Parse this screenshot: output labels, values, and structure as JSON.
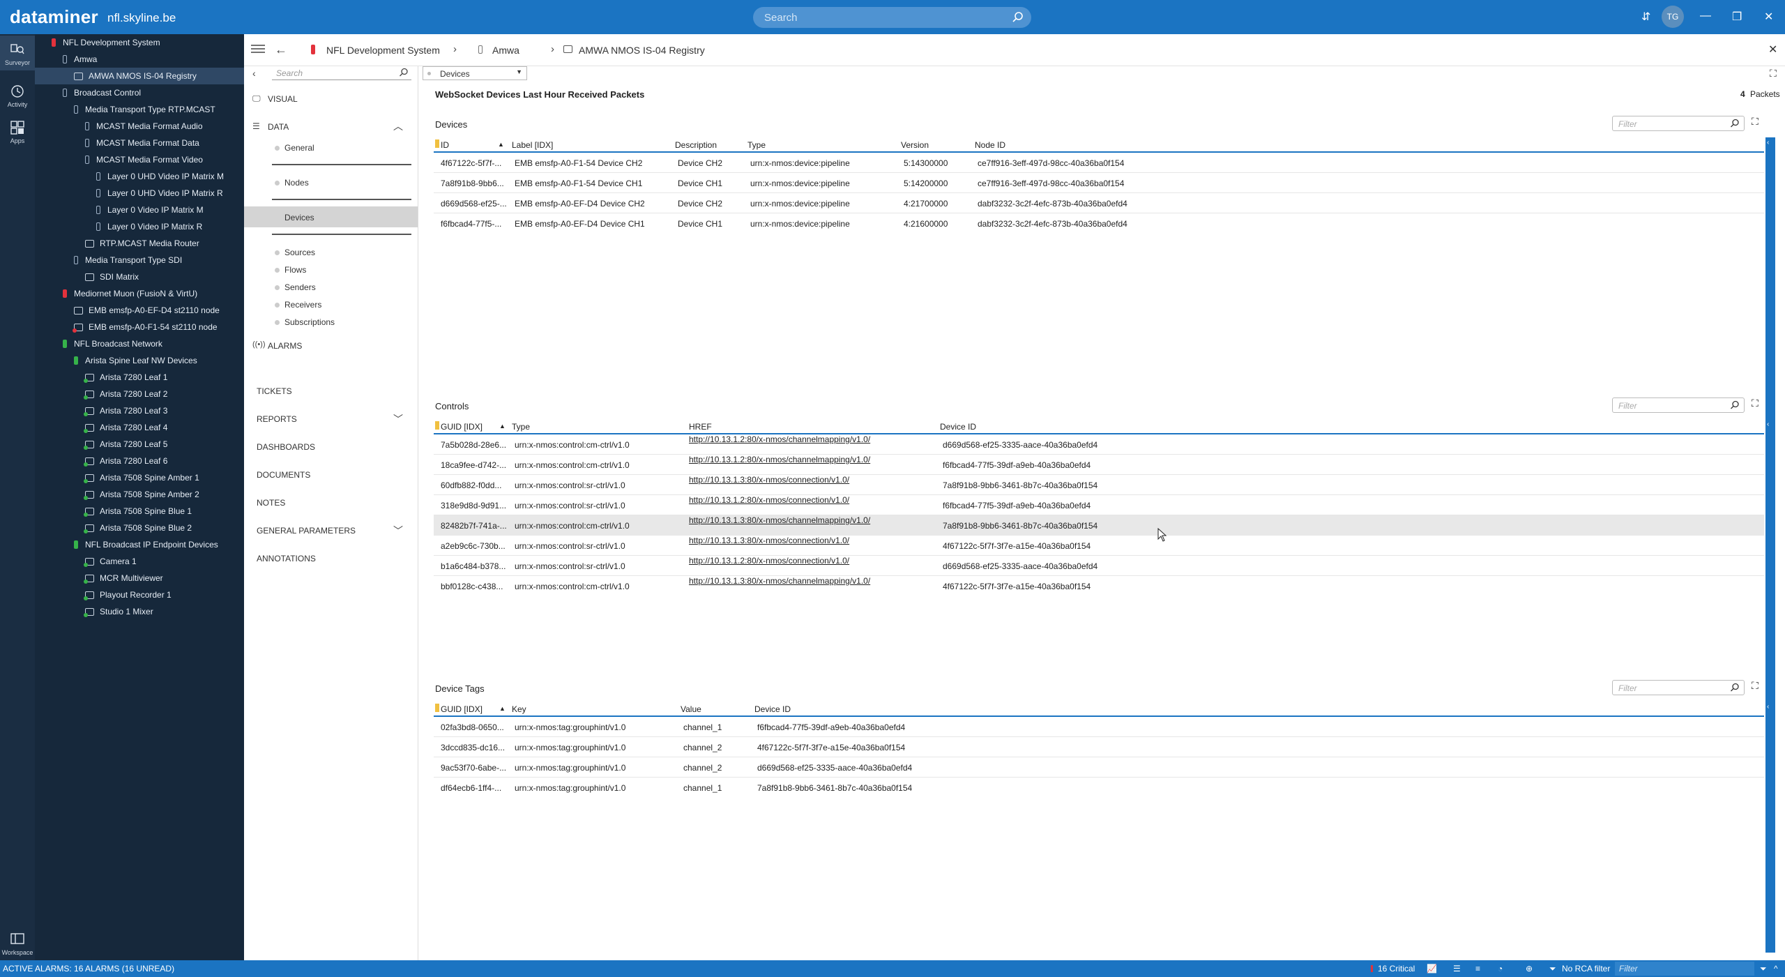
{
  "topbar": {
    "brand": "dataminer",
    "host": "nfl.skyline.be",
    "search_placeholder": "Search",
    "user_initials": "TG"
  },
  "rail": {
    "items": [
      {
        "label": "Surveyor"
      },
      {
        "label": "Activity"
      },
      {
        "label": "Apps"
      }
    ],
    "bottom": {
      "label": "Workspace"
    }
  },
  "tree": {
    "nodes": [
      {
        "label": "NFL Development System",
        "status": "red",
        "level": 0,
        "kind": "view"
      },
      {
        "label": "Amwa",
        "status": "none",
        "level": 1,
        "kind": "view"
      },
      {
        "label": "AMWA NMOS IS-04 Registry",
        "status": "none",
        "level": 2,
        "kind": "element"
      },
      {
        "label": "Broadcast Control",
        "status": "none",
        "level": 0,
        "kind": "view"
      },
      {
        "label": "Media Transport Type RTP.MCAST",
        "status": "none",
        "level": 1,
        "kind": "view"
      },
      {
        "label": "MCAST Media Format Audio",
        "status": "none",
        "level": 2,
        "kind": "view"
      },
      {
        "label": "MCAST Media Format Data",
        "status": "none",
        "level": 2,
        "kind": "view"
      },
      {
        "label": "MCAST Media Format Video",
        "status": "none",
        "level": 2,
        "kind": "view"
      },
      {
        "label": "Layer 0 UHD Video IP Matrix M",
        "status": "none",
        "level": 3,
        "kind": "element"
      },
      {
        "label": "Layer 0 UHD Video IP Matrix R",
        "status": "none",
        "level": 3,
        "kind": "element"
      },
      {
        "label": "Layer 0 Video IP Matrix M",
        "status": "none",
        "level": 3,
        "kind": "element"
      },
      {
        "label": "Layer 0 Video IP Matrix R",
        "status": "none",
        "level": 3,
        "kind": "element"
      },
      {
        "label": "RTP.MCAST Media Router",
        "status": "none",
        "level": 2,
        "kind": "element"
      },
      {
        "label": "Media Transport Type SDI",
        "status": "none",
        "level": 1,
        "kind": "view"
      },
      {
        "label": "SDI Matrix",
        "status": "none",
        "level": 2,
        "kind": "element"
      },
      {
        "label": "Mediornet Muon (FusioN & VirtU)",
        "status": "red",
        "level": 0,
        "kind": "view"
      },
      {
        "label": "EMB emsfp-A0-EF-D4 st2110 node",
        "status": "none",
        "level": 1,
        "kind": "element"
      },
      {
        "label": "EMB emsfp-A0-F1-54 st2110 node",
        "status": "red",
        "level": 1,
        "kind": "element"
      },
      {
        "label": "NFL Broadcast Network",
        "status": "green",
        "level": 0,
        "kind": "view"
      },
      {
        "label": "Arista Spine Leaf NW Devices",
        "status": "green",
        "level": 1,
        "kind": "view"
      },
      {
        "label": "Arista 7280 Leaf 1",
        "status": "green",
        "level": 2,
        "kind": "element"
      },
      {
        "label": "Arista 7280 Leaf 2",
        "status": "green",
        "level": 2,
        "kind": "element"
      },
      {
        "label": "Arista 7280 Leaf 3",
        "status": "green",
        "level": 2,
        "kind": "element"
      },
      {
        "label": "Arista 7280 Leaf 4",
        "status": "green",
        "level": 2,
        "kind": "element"
      },
      {
        "label": "Arista 7280 Leaf 5",
        "status": "green",
        "level": 2,
        "kind": "element"
      },
      {
        "label": "Arista 7280 Leaf 6",
        "status": "green",
        "level": 2,
        "kind": "element"
      },
      {
        "label": "Arista 7508 Spine Amber 1",
        "status": "green",
        "level": 2,
        "kind": "element"
      },
      {
        "label": "Arista 7508 Spine Amber 2",
        "status": "green",
        "level": 2,
        "kind": "element"
      },
      {
        "label": "Arista 7508 Spine Blue 1",
        "status": "green",
        "level": 2,
        "kind": "element"
      },
      {
        "label": "Arista 7508 Spine Blue 2",
        "status": "green",
        "level": 2,
        "kind": "element"
      },
      {
        "label": "NFL Broadcast IP Endpoint Devices",
        "status": "green",
        "level": 1,
        "kind": "view"
      },
      {
        "label": "Camera 1",
        "status": "green",
        "level": 2,
        "kind": "element"
      },
      {
        "label": "MCR Multiviewer",
        "status": "green",
        "level": 2,
        "kind": "element"
      },
      {
        "label": "Playout Recorder 1",
        "status": "green",
        "level": 2,
        "kind": "element"
      },
      {
        "label": "Studio 1 Mixer",
        "status": "green",
        "level": 2,
        "kind": "element"
      }
    ]
  },
  "breadcrumb": {
    "items": [
      "NFL Development System",
      "Amwa",
      "AMWA NMOS IS-04 Registry"
    ]
  },
  "appnav": {
    "search_placeholder": "Search",
    "visual": "VISUAL",
    "data": "DATA",
    "data_items": [
      "General",
      "Nodes",
      "Devices",
      "Sources",
      "Flows",
      "Senders",
      "Receivers",
      "Subscriptions"
    ],
    "alarms": "ALARMS",
    "tickets": "TICKETS",
    "reports": "REPORTS",
    "dashboards": "DASHBOARDS",
    "documents": "DOCUMENTS",
    "notes": "NOTES",
    "general_parameters": "GENERAL PARAMETERS",
    "annotations": "ANNOTATIONS"
  },
  "main": {
    "page_selector": "Devices",
    "websocket_title": "WebSocket Devices Last Hour Received Packets",
    "packets_value": "4",
    "packets_unit": "Packets",
    "filter_placeholder": "Filter",
    "devices": {
      "title": "Devices",
      "columns": [
        "ID",
        "Label [IDX]",
        "Description",
        "Type",
        "Version",
        "Node ID"
      ],
      "rows": [
        [
          "4f67122c-5f7f-...",
          "EMB emsfp-A0-F1-54 Device CH2",
          "Device CH2",
          "urn:x-nmos:device:pipeline",
          "5:14300000",
          "ce7ff916-3eff-497d-98cc-40a36ba0f154"
        ],
        [
          "7a8f91b8-9bb6...",
          "EMB emsfp-A0-F1-54 Device CH1",
          "Device CH1",
          "urn:x-nmos:device:pipeline",
          "5:14200000",
          "ce7ff916-3eff-497d-98cc-40a36ba0f154"
        ],
        [
          "d669d568-ef25-...",
          "EMB emsfp-A0-EF-D4 Device CH2",
          "Device CH2",
          "urn:x-nmos:device:pipeline",
          "4:21700000",
          "dabf3232-3c2f-4efc-873b-40a36ba0efd4"
        ],
        [
          "f6fbcad4-77f5-...",
          "EMB emsfp-A0-EF-D4 Device CH1",
          "Device CH1",
          "urn:x-nmos:device:pipeline",
          "4:21600000",
          "dabf3232-3c2f-4efc-873b-40a36ba0efd4"
        ]
      ]
    },
    "controls": {
      "title": "Controls",
      "columns": [
        "GUID [IDX]",
        "Type",
        "HREF",
        "Device ID"
      ],
      "rows": [
        [
          "7a5b028d-28e6...",
          "urn:x-nmos:control:cm-ctrl/v1.0",
          "http://10.13.1.2:80/x-nmos/channelmapping/v1.0/",
          "d669d568-ef25-3335-aace-40a36ba0efd4"
        ],
        [
          "18ca9fee-d742-...",
          "urn:x-nmos:control:cm-ctrl/v1.0",
          "http://10.13.1.2:80/x-nmos/channelmapping/v1.0/",
          "f6fbcad4-77f5-39df-a9eb-40a36ba0efd4"
        ],
        [
          "60dfb882-f0dd...",
          "urn:x-nmos:control:sr-ctrl/v1.0",
          "http://10.13.1.3:80/x-nmos/connection/v1.0/",
          "7a8f91b8-9bb6-3461-8b7c-40a36ba0f154"
        ],
        [
          "318e9d8d-9d91...",
          "urn:x-nmos:control:sr-ctrl/v1.0",
          "http://10.13.1.2:80/x-nmos/connection/v1.0/",
          "f6fbcad4-77f5-39df-a9eb-40a36ba0efd4"
        ],
        [
          "82482b7f-741a-...",
          "urn:x-nmos:control:cm-ctrl/v1.0",
          "http://10.13.1.3:80/x-nmos/channelmapping/v1.0/",
          "7a8f91b8-9bb6-3461-8b7c-40a36ba0f154"
        ],
        [
          "a2eb9c6c-730b...",
          "urn:x-nmos:control:sr-ctrl/v1.0",
          "http://10.13.1.3:80/x-nmos/connection/v1.0/",
          "4f67122c-5f7f-3f7e-a15e-40a36ba0f154"
        ],
        [
          "b1a6c484-b378...",
          "urn:x-nmos:control:sr-ctrl/v1.0",
          "http://10.13.1.2:80/x-nmos/connection/v1.0/",
          "d669d568-ef25-3335-aace-40a36ba0efd4"
        ],
        [
          "bbf0128c-c438...",
          "urn:x-nmos:control:cm-ctrl/v1.0",
          "http://10.13.1.3:80/x-nmos/channelmapping/v1.0/",
          "4f67122c-5f7f-3f7e-a15e-40a36ba0f154"
        ]
      ]
    },
    "device_tags": {
      "title": "Device Tags",
      "columns": [
        "GUID [IDX]",
        "Key",
        "Value",
        "Device ID"
      ],
      "rows": [
        [
          "02fa3bd8-0650...",
          "urn:x-nmos:tag:grouphint/v1.0",
          "channel_1",
          "f6fbcad4-77f5-39df-a9eb-40a36ba0efd4"
        ],
        [
          "3dccd835-dc16...",
          "urn:x-nmos:tag:grouphint/v1.0",
          "channel_2",
          "4f67122c-5f7f-3f7e-a15e-40a36ba0f154"
        ],
        [
          "9ac53f70-6abe-...",
          "urn:x-nmos:tag:grouphint/v1.0",
          "channel_2",
          "d669d568-ef25-3335-aace-40a36ba0efd4"
        ],
        [
          "df64ecb6-1ff4-...",
          "urn:x-nmos:tag:grouphint/v1.0",
          "channel_1",
          "7a8f91b8-9bb6-3461-8b7c-40a36ba0f154"
        ]
      ]
    }
  },
  "statusbar": {
    "alarms_text": "ACTIVE ALARMS: 16 ALARMS (16 UNREAD)",
    "critical": "16 Critical",
    "rca": "No RCA filter",
    "filter_placeholder": "Filter"
  },
  "colors": {
    "accent": "#1b74c2",
    "tree_bg": "#16283b",
    "rail_bg": "#1a2d42",
    "critical": "#e3323c",
    "normal": "#36b34a"
  }
}
